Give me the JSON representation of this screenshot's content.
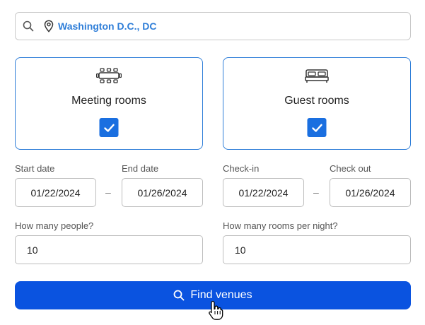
{
  "search": {
    "location": "Washington D.C., DC",
    "icon": "search-icon",
    "pin_icon": "location-pin-icon"
  },
  "options": [
    {
      "label": "Meeting rooms",
      "icon": "meeting-table-icon",
      "checked": true
    },
    {
      "label": "Guest rooms",
      "icon": "bed-icon",
      "checked": true
    }
  ],
  "meeting": {
    "start_label": "Start date",
    "end_label": "End date",
    "start_value": "01/22/2024",
    "end_value": "01/26/2024",
    "separator": "–",
    "people_label": "How many people?",
    "people_value": "10"
  },
  "guest": {
    "checkin_label": "Check-in",
    "checkout_label": "Check out",
    "checkin_value": "01/22/2024",
    "checkout_value": "01/26/2024",
    "separator": "–",
    "rooms_label": "How many rooms per night?",
    "rooms_value": "10"
  },
  "cta": {
    "label": "Find venues",
    "icon": "search-icon"
  },
  "colors": {
    "accent": "#2f7ed8",
    "checkbox": "#1a6fe0",
    "button": "#0a53e0",
    "border": "#c9c9c9"
  }
}
